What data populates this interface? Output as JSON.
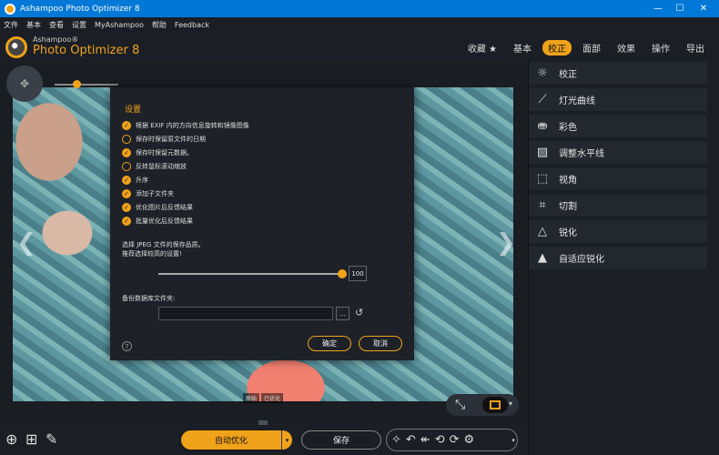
{
  "window": {
    "title": "Ashampoo Photo Optimizer 8",
    "controls": [
      "—",
      "☐",
      "✕"
    ]
  },
  "menu": [
    "文件",
    "基本",
    "查看",
    "设置",
    "MyAshampoo",
    "帮助",
    "Feedback"
  ],
  "brand": {
    "small": "Ashampoo®",
    "big": "Photo Optimizer 8"
  },
  "top_tabs": [
    {
      "label": "收藏 ★",
      "active": false
    },
    {
      "label": "基本",
      "active": false
    },
    {
      "label": "校正",
      "active": true
    },
    {
      "label": "面部",
      "active": false
    },
    {
      "label": "效果",
      "active": false
    },
    {
      "label": "操作",
      "active": false
    },
    {
      "label": "导出",
      "active": false
    }
  ],
  "viewer": {
    "split_labels": [
      "原始",
      "已优化"
    ],
    "nav_left": "❮",
    "nav_right": "❯"
  },
  "dialog": {
    "title": "设置",
    "options": [
      {
        "label": "根据 EXIF 内的方向信息旋转和镜像图像",
        "checked": true
      },
      {
        "label": "保存时保留原文件的日期",
        "checked": false
      },
      {
        "label": "保存时保留元数据。",
        "checked": true
      },
      {
        "label": "反转鼠标滚动缩放",
        "checked": false
      },
      {
        "label": "升序",
        "checked": true
      },
      {
        "label": "添加子文件夹",
        "checked": true
      },
      {
        "label": "优化图片后反馈结果",
        "checked": true
      },
      {
        "label": "批量优化后反馈结果",
        "checked": true
      }
    ],
    "jpeg_label_line1": "选择 JPEG 文件的保存品质。",
    "jpeg_label_line2": "推荐选择较高的设置!",
    "jpeg_quality": 100,
    "jpeg_quality_text": "100",
    "backup_label": "备份数据库文件夹:",
    "backup_value": "",
    "browse_label": "...",
    "help_label": "?",
    "ok_label": "确定",
    "cancel_label": "取消"
  },
  "tools": [
    {
      "label": "校正",
      "icon": "sun-icon"
    },
    {
      "label": "灯光曲线",
      "icon": "curve-icon"
    },
    {
      "label": "彩色",
      "icon": "color-bag-icon"
    },
    {
      "label": "调整水平线",
      "icon": "horizon-image-icon"
    },
    {
      "label": "视角",
      "icon": "perspective-icon"
    },
    {
      "label": "切割",
      "icon": "crop-icon"
    },
    {
      "label": "锐化",
      "icon": "triangle-icon"
    },
    {
      "label": "自适应锐化",
      "icon": "adaptive-sharpen-icon"
    }
  ],
  "bottom": {
    "auto_label": "自动优化",
    "save_label": "保存"
  },
  "colors": {
    "accent": "#f0a21a",
    "titlebar": "#0078d7",
    "background": "#1b1e24"
  }
}
